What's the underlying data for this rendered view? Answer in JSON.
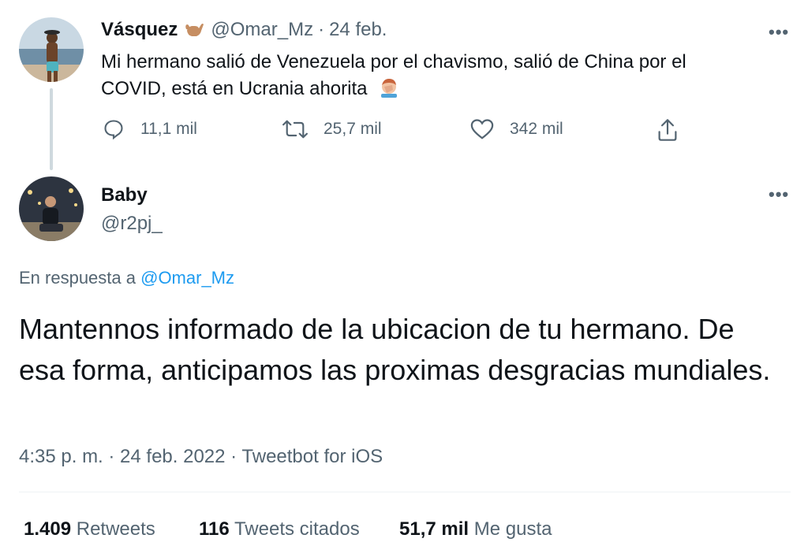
{
  "original_tweet": {
    "name": "Vásquez",
    "handle": "@Omar_Mz",
    "separator": "·",
    "date": "24 feb.",
    "text": "Mi hermano salió de Venezuela por el chavismo, salió de China por el COVID, está en Ucrania ahorita",
    "name_emoji": "call-me-hand-emoji",
    "text_emoji": "facepalm-emoji",
    "actions": {
      "replies": "11,1 mil",
      "retweets": "25,7 mil",
      "likes": "342 mil"
    }
  },
  "reply_tweet": {
    "name": "Baby",
    "handle": "@r2pj_",
    "reply_prefix": "En respuesta a",
    "reply_to": "@Omar_Mz",
    "text": "Mantennos informado de la ubicacion de tu hermano. De esa forma, anticipamos las proximas desgracias mundiales.",
    "timestamp": "4:35 p. m. · 24 feb. 2022 · Tweetbot for iOS"
  },
  "more_icon": "•••",
  "stats": {
    "retweets_count": "1.409",
    "retweets_label": "Retweets",
    "quotes_count": "116",
    "quotes_label": "Tweets citados",
    "likes_count": "51,7 mil",
    "likes_label": "Me gusta"
  },
  "colors": {
    "text": "#0f1419",
    "muted": "#536471",
    "link": "#1d9bf0",
    "thread_line": "#cfd9de"
  }
}
